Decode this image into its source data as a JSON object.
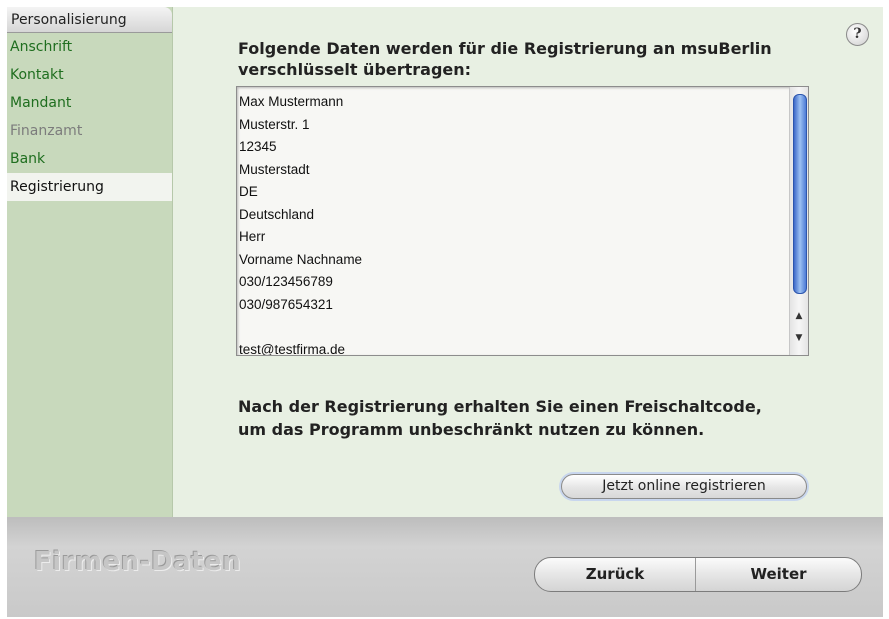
{
  "sidebar": {
    "header": "Personalisierung",
    "items": [
      {
        "label": "Anschrift",
        "state": "enabled"
      },
      {
        "label": "Kontakt",
        "state": "enabled"
      },
      {
        "label": "Mandant",
        "state": "enabled"
      },
      {
        "label": "Finanzamt",
        "state": "disabled"
      },
      {
        "label": "Bank",
        "state": "enabled"
      },
      {
        "label": "Registrierung",
        "state": "active"
      }
    ]
  },
  "help": {
    "label": "?"
  },
  "main": {
    "intro": "Folgende Daten werden für die Registrierung an msuBerlin verschlüsselt übertragen:",
    "data_lines": [
      "Max Mustermann",
      "Musterstr. 1",
      "12345",
      "Musterstadt",
      "DE",
      "Deutschland",
      "Herr",
      "Vorname Nachname",
      "030/123456789",
      "030/987654321",
      "",
      "test@testfirma.de"
    ],
    "outro_line1": "Nach der Registrierung erhalten Sie einen Freischaltcode,",
    "outro_line2": "um das Programm unbeschränkt nutzen zu können.",
    "register_button": "Jetzt online registrieren"
  },
  "footer": {
    "brand": "Firmen-Daten",
    "back_button": "Zurück",
    "next_button": "Weiter"
  },
  "colors": {
    "content_bg": "#e8f0e3",
    "sidebar_bg": "#c8d9bc",
    "sidebar_link": "#1f6e1f",
    "scroll_thumb": "#4d7bd6"
  }
}
